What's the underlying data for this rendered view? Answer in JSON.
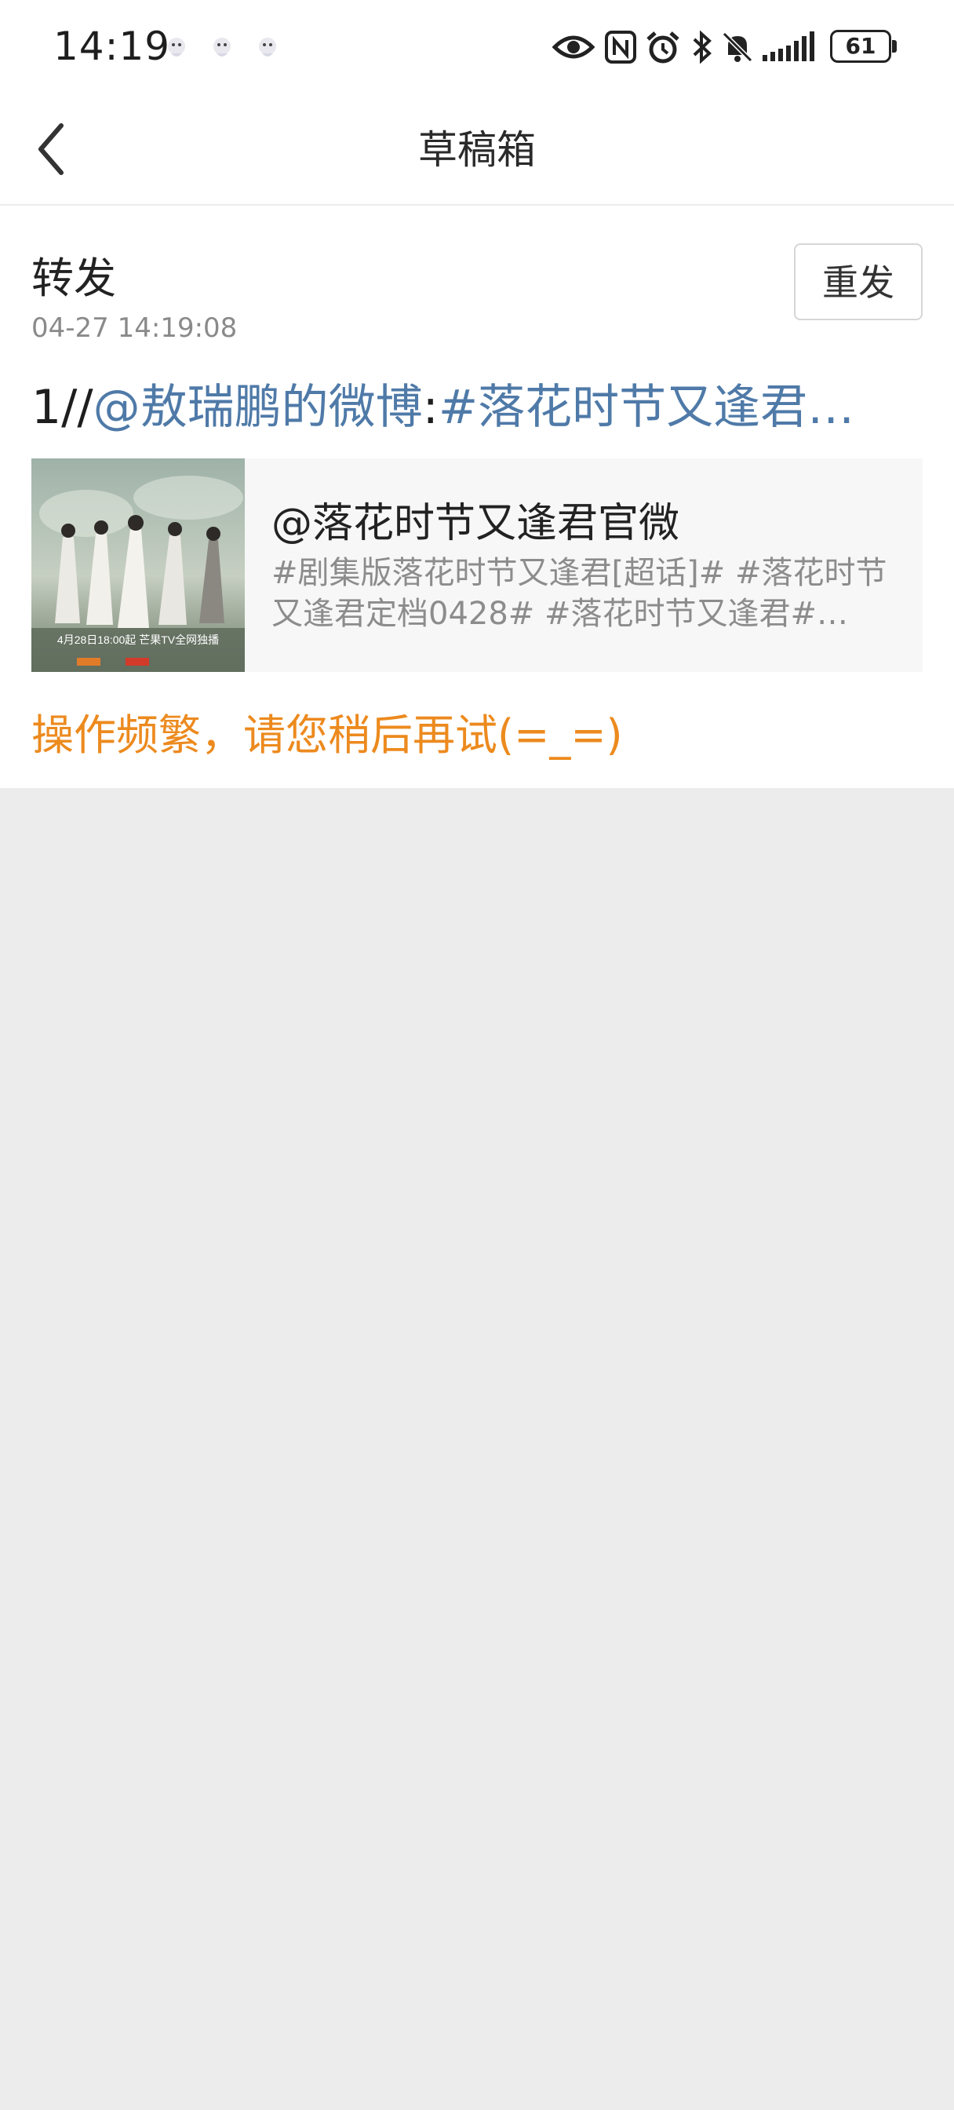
{
  "status_bar": {
    "time": "14:19",
    "battery": "61",
    "icons": [
      "qq-notification-icon",
      "qq-notification-icon",
      "qq-notification-icon",
      "eye-icon",
      "nfc-icon",
      "alarm-icon",
      "bluetooth-icon",
      "mute-bell-icon",
      "signal-icon",
      "battery-icon"
    ]
  },
  "header": {
    "title": "草稿箱",
    "back_icon": "chevron-left-icon"
  },
  "draft": {
    "type": "转发",
    "time": "04-27 14:19:08",
    "resend_label": "重发",
    "text_prefix": "1//",
    "mention": "@敖瑞鹏的微博",
    "colon": ":",
    "topic": "#落花时节又逢君…",
    "quoted": {
      "author": "@落花时节又逢君官微",
      "text": "#剧集版落花时节又逢君[超话]# #落花时节又逢君定档0428# #落花时节又逢君#…",
      "thumbnail_caption": "4月28日18:00起 芒果TV全网独播"
    },
    "error": "操作频繁，请您稍后再试(=_=)"
  },
  "colors": {
    "link_blue": "#4f7aa8",
    "error_orange": "#ec8a1e",
    "background": "#ececec"
  }
}
